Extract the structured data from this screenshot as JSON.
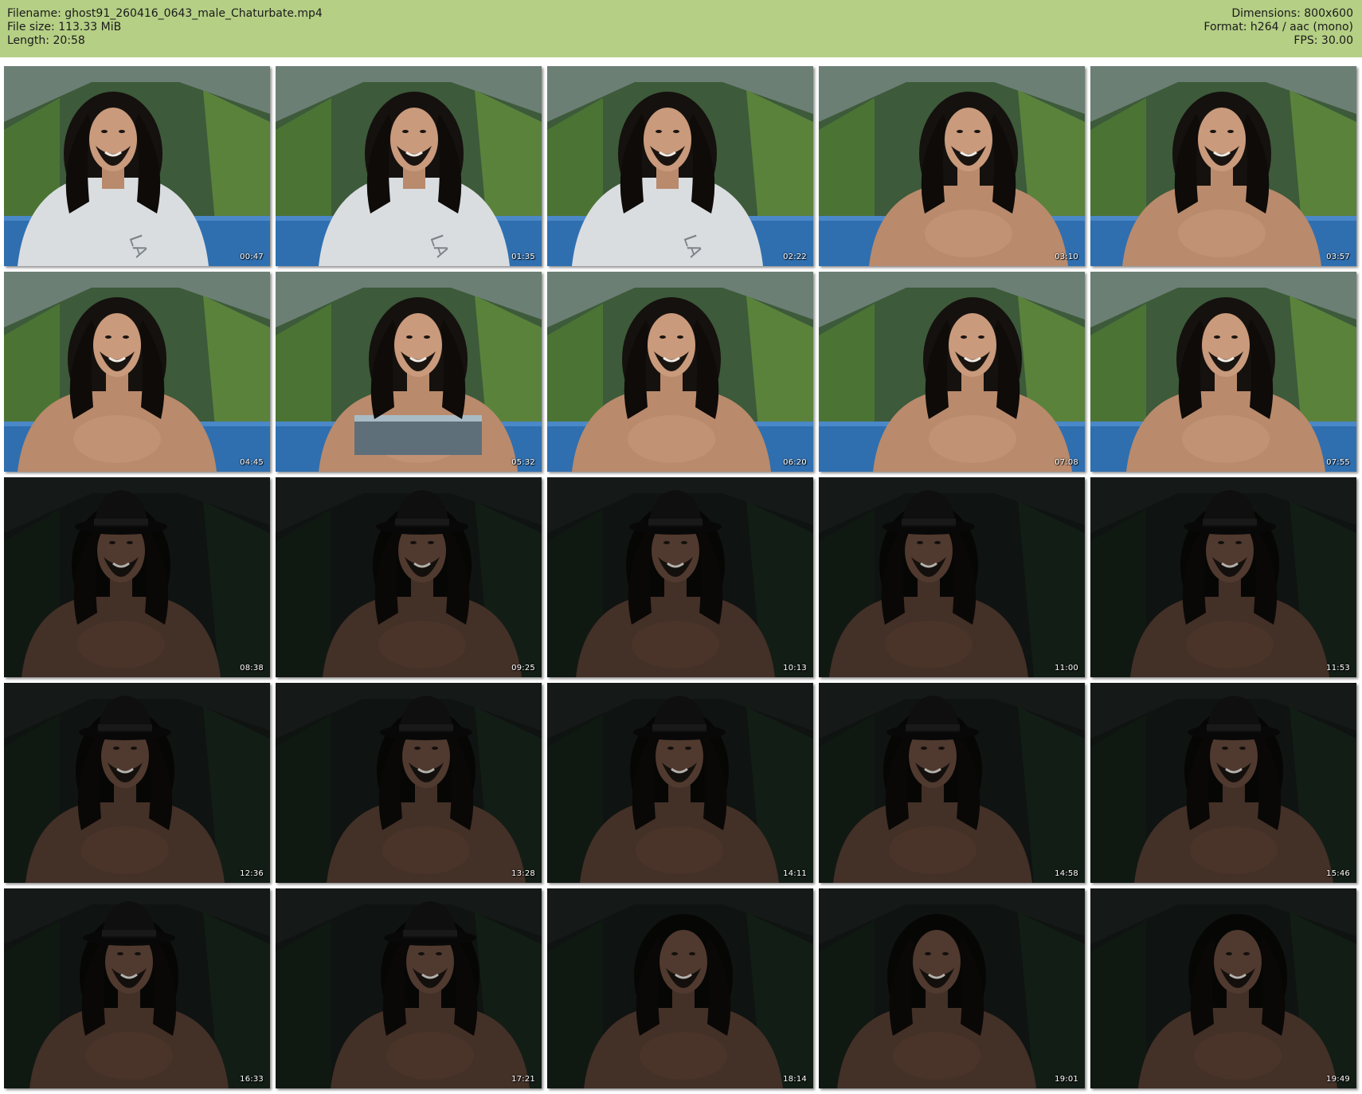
{
  "header": {
    "filename": "Filename: ghost91_260416_0643_male_Chaturbate.mp4",
    "filesize": "File size: 113.33 MiB",
    "length": "Length: 20:58",
    "dimensions": "Dimensions: 800x600",
    "format": "Format: h264 / aac (mono)",
    "fps": "FPS: 30.00"
  },
  "frames": [
    {
      "timestamp": "00:47",
      "scene": "bright",
      "wear": "shirt",
      "hat": false
    },
    {
      "timestamp": "01:35",
      "scene": "bright",
      "wear": "shirt",
      "hat": false
    },
    {
      "timestamp": "02:22",
      "scene": "bright",
      "wear": "shirt",
      "hat": false
    },
    {
      "timestamp": "03:10",
      "scene": "bright",
      "wear": "bare",
      "hat": false
    },
    {
      "timestamp": "03:57",
      "scene": "bright",
      "wear": "bare",
      "hat": false
    },
    {
      "timestamp": "04:45",
      "scene": "bright",
      "wear": "bare",
      "hat": false
    },
    {
      "timestamp": "05:32",
      "scene": "bright",
      "wear": "shorts",
      "hat": false
    },
    {
      "timestamp": "06:20",
      "scene": "bright",
      "wear": "bare",
      "hat": false
    },
    {
      "timestamp": "07:08",
      "scene": "bright",
      "wear": "bare",
      "hat": false
    },
    {
      "timestamp": "07:55",
      "scene": "bright",
      "wear": "bare",
      "hat": false
    },
    {
      "timestamp": "08:38",
      "scene": "dark",
      "wear": "bare",
      "hat": true
    },
    {
      "timestamp": "09:25",
      "scene": "dark",
      "wear": "bare",
      "hat": true
    },
    {
      "timestamp": "10:13",
      "scene": "dark",
      "wear": "bare",
      "hat": true
    },
    {
      "timestamp": "11:00",
      "scene": "dark",
      "wear": "bare",
      "hat": true
    },
    {
      "timestamp": "11:53",
      "scene": "dark",
      "wear": "bare",
      "hat": true
    },
    {
      "timestamp": "12:36",
      "scene": "dark",
      "wear": "bare",
      "hat": true
    },
    {
      "timestamp": "13:28",
      "scene": "dark",
      "wear": "bare",
      "hat": true
    },
    {
      "timestamp": "14:11",
      "scene": "dark",
      "wear": "bare",
      "hat": true
    },
    {
      "timestamp": "14:58",
      "scene": "dark",
      "wear": "bare",
      "hat": true
    },
    {
      "timestamp": "15:46",
      "scene": "dark",
      "wear": "bare",
      "hat": true
    },
    {
      "timestamp": "16:33",
      "scene": "dark",
      "wear": "bare",
      "hat": true
    },
    {
      "timestamp": "17:21",
      "scene": "dark",
      "wear": "bare",
      "hat": true
    },
    {
      "timestamp": "18:14",
      "scene": "dark",
      "wear": "bare",
      "hat": false
    },
    {
      "timestamp": "19:01",
      "scene": "dark",
      "wear": "bare",
      "hat": false
    },
    {
      "timestamp": "19:49",
      "scene": "dark",
      "wear": "bare",
      "hat": false
    }
  ],
  "colors": {
    "header_bg": "#b5cf85",
    "page_bg": "#ffffff"
  }
}
